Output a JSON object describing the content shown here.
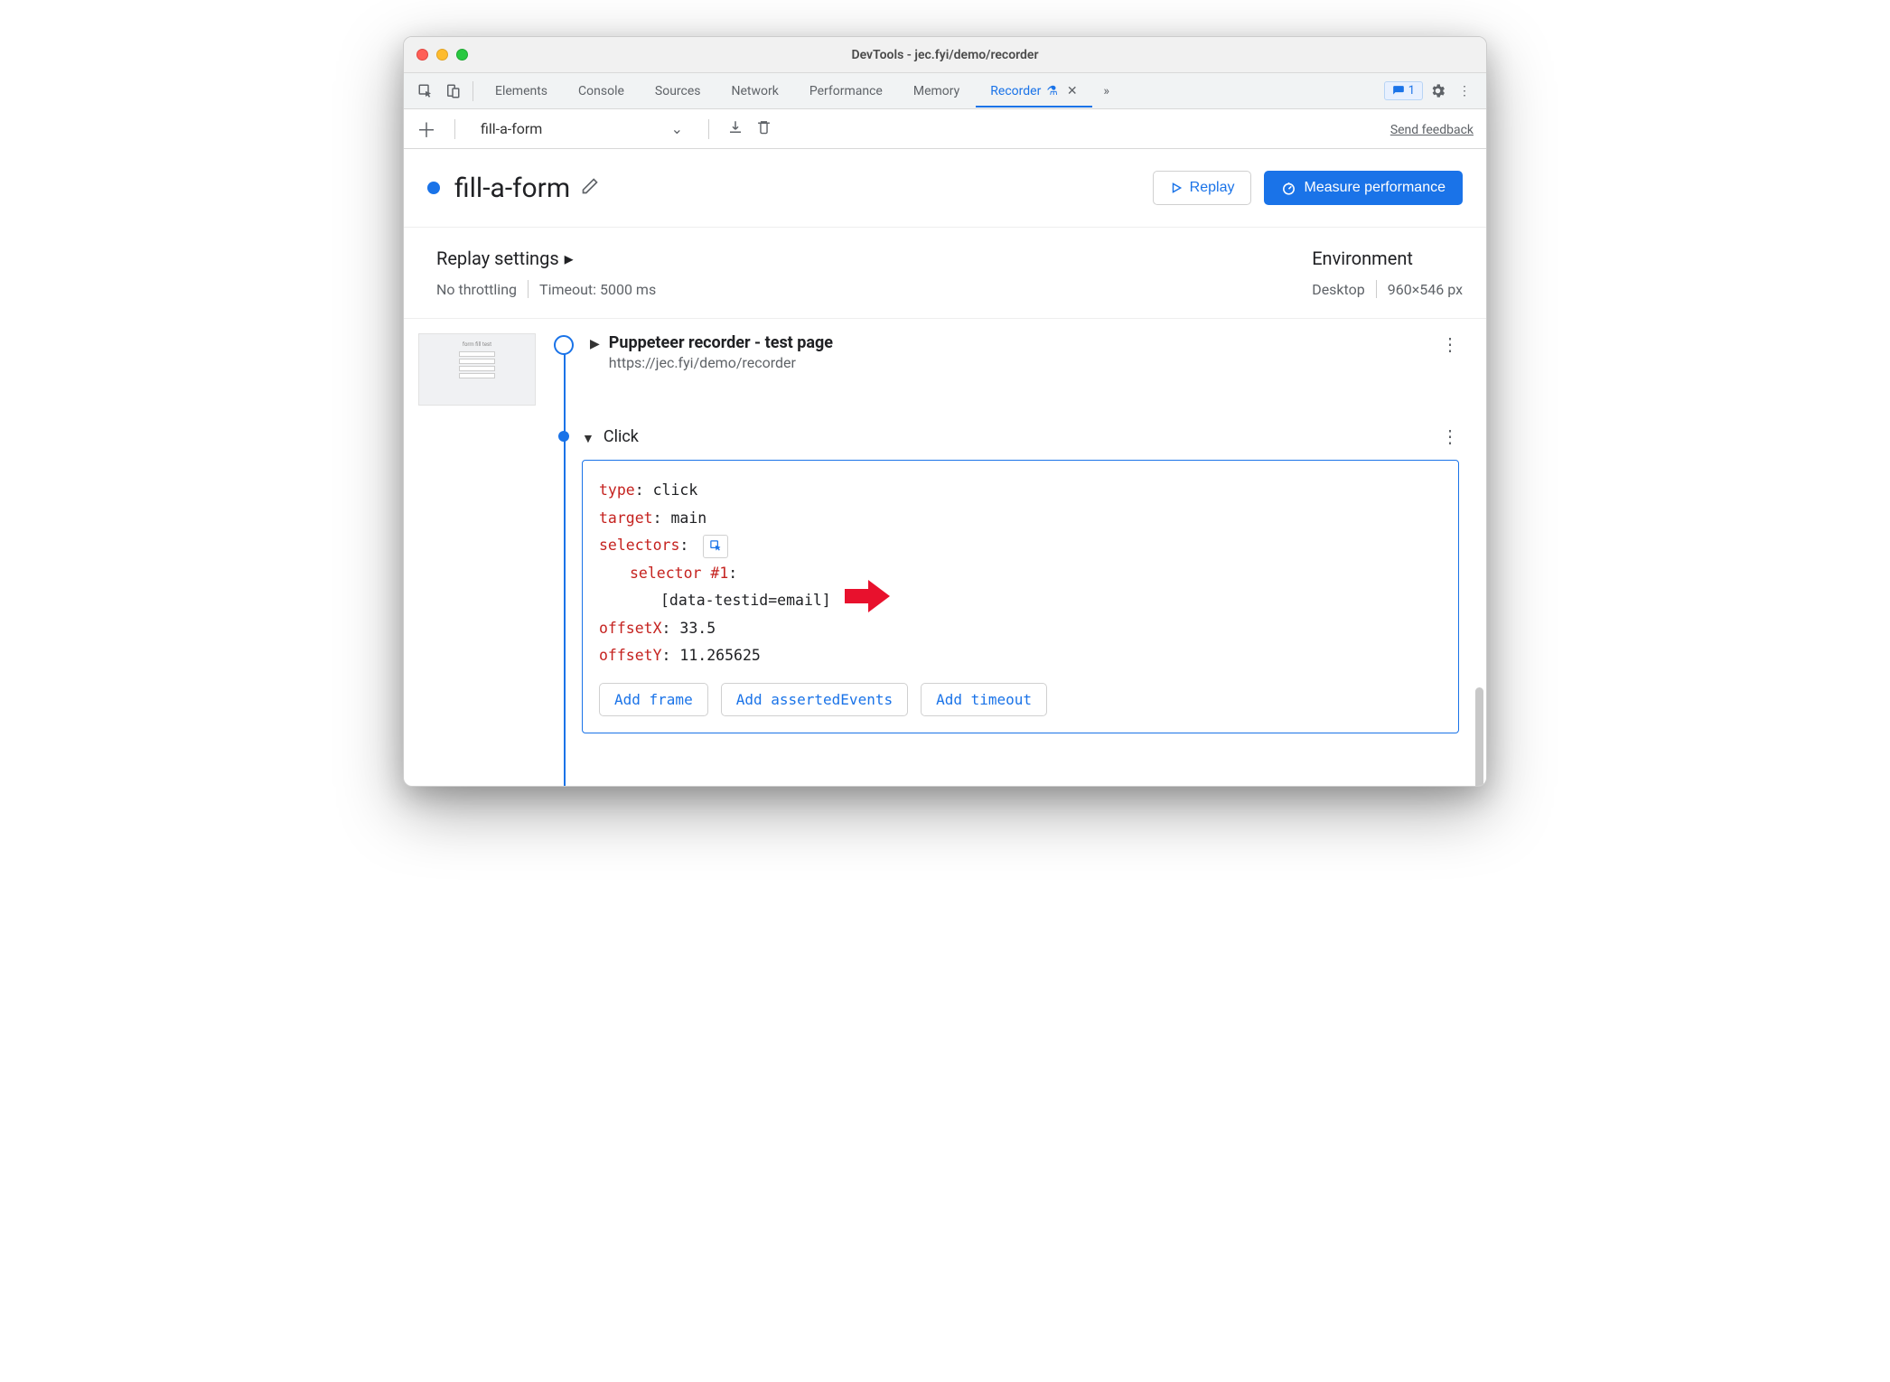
{
  "window": {
    "title": "DevTools - jec.fyi/demo/recorder"
  },
  "tabs": {
    "items": [
      "Elements",
      "Console",
      "Sources",
      "Network",
      "Performance",
      "Memory"
    ],
    "active": "Recorder",
    "badge_count": "1"
  },
  "toolbar": {
    "recording_name": "fill-a-form",
    "send_feedback": "Send feedback"
  },
  "header": {
    "title": "fill-a-form",
    "replay_btn": "Replay",
    "measure_btn": "Measure performance"
  },
  "settings": {
    "replay_title": "Replay settings",
    "throttling": "No throttling",
    "timeout": "Timeout: 5000 ms",
    "env_title": "Environment",
    "env_device": "Desktop",
    "env_size": "960×546 px"
  },
  "steps": {
    "root": {
      "title": "Puppeteer recorder - test page",
      "url": "https://jec.fyi/demo/recorder"
    },
    "click": {
      "label": "Click",
      "type_key": "type",
      "type_val": "click",
      "target_key": "target",
      "target_val": "main",
      "selectors_key": "selectors",
      "selector1_key": "selector #1",
      "selector1_val": "[data-testid=email]",
      "offsetx_key": "offsetX",
      "offsetx_val": "33.5",
      "offsety_key": "offsetY",
      "offsety_val": "11.265625",
      "add_frame": "Add frame",
      "add_asserted": "Add assertedEvents",
      "add_timeout": "Add timeout"
    }
  }
}
